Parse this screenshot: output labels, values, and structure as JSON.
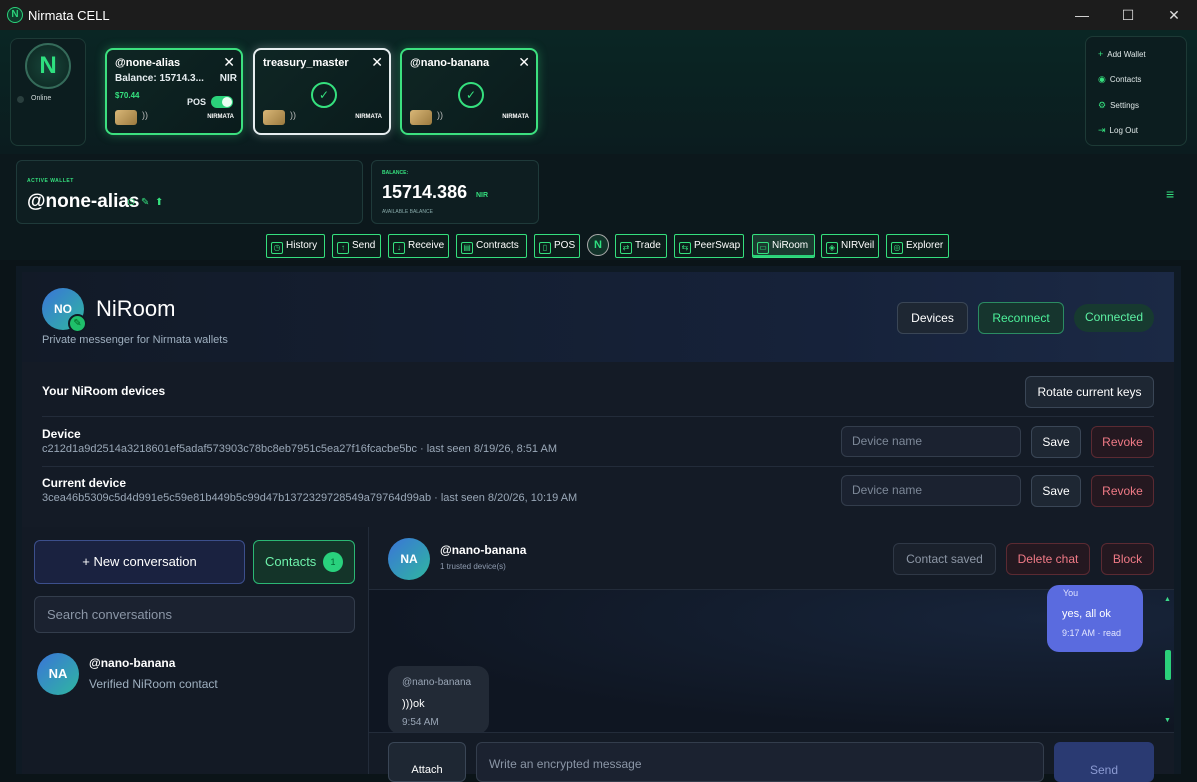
{
  "window": {
    "title": "Nirmata CELL",
    "logo_glyph": "N",
    "minimize": "—",
    "maximize": "☐",
    "close": "✕"
  },
  "profile": {
    "status": "Online",
    "glyph": "N"
  },
  "wallet_cards": [
    {
      "name": "@none-alias",
      "balance": "Balance: 15714.3...",
      "balance_unit": "NIR",
      "usd": "$70.44",
      "pos_label": "POS",
      "pos_enabled": true,
      "brand": "NIRMATA",
      "close": "✕",
      "nfc": "))"
    },
    {
      "name": "treasury_master",
      "brand": "NIRMATA",
      "close": "✕",
      "nfc": "))",
      "shield": "✓"
    },
    {
      "name": "@nano-banana",
      "brand": "NIRMATA",
      "close": "✕",
      "nfc": "))",
      "shield": "✓"
    }
  ],
  "side_menu": [
    {
      "label": "Add Wallet",
      "icon": "+"
    },
    {
      "label": "Contacts",
      "icon": "◉"
    },
    {
      "label": "Settings",
      "icon": "⚙"
    },
    {
      "label": "Log Out",
      "icon": "⇥"
    }
  ],
  "active_wallet": {
    "label": "ACTIVE WALLET",
    "alias": "@none-alias",
    "icons": [
      "⊙",
      "✎",
      "⬆"
    ]
  },
  "balance": {
    "label": "BALANCE:",
    "value": "15714.386",
    "unit": "NIR",
    "sub": "AVAILABLE BALANCE"
  },
  "hamburger": "≡",
  "nav": [
    {
      "label": "History",
      "icon": "◷"
    },
    {
      "label": "Send",
      "icon": "↑"
    },
    {
      "label": "Receive",
      "icon": "↓"
    },
    {
      "label": "Contracts",
      "icon": "▤"
    },
    {
      "label": "POS",
      "icon": "▯"
    },
    {
      "label": "Trade",
      "icon": "⇄"
    },
    {
      "label": "PeerSwap",
      "icon": "⇆"
    },
    {
      "label": "NiRoom",
      "icon": "▭",
      "active": true
    },
    {
      "label": "NIRVeil",
      "icon": "◈"
    },
    {
      "label": "Explorer",
      "icon": "◎"
    }
  ],
  "nav_logo": "N",
  "niroom": {
    "avatar": "NO",
    "badge": "✎",
    "title": "NiRoom",
    "subtitle": "Private messenger for Nirmata wallets",
    "devices_btn": "Devices",
    "reconnect_btn": "Reconnect",
    "status": "Connected"
  },
  "devices": {
    "title": "Your NiRoom devices",
    "rotate_btn": "Rotate current keys",
    "placeholder": "Device name",
    "save": "Save",
    "revoke": "Revoke",
    "list": [
      {
        "label": "Device",
        "id": "c212d1a9d2514a3218601ef5adaf573903c78bc8eb7951c5ea27f16fcacbe5bc · last seen 8/19/26, 8:51 AM"
      },
      {
        "label": "Current device",
        "id": "3cea46b5309c5d4d991e5c59e81b449b5c99d47b1372329728549a79764d99ab · last seen 8/20/26, 10:19 AM"
      }
    ]
  },
  "sidebar": {
    "new_conv": "+ New conversation",
    "contacts": "Contacts",
    "contacts_count": "1",
    "search_placeholder": "Search conversations",
    "conversations": [
      {
        "avatar": "NA",
        "name": "@nano-banana",
        "sub": "Verified NiRoom contact"
      }
    ]
  },
  "chat": {
    "avatar": "NA",
    "name": "@nano-banana",
    "trusted": "1 trusted device(s)",
    "contact_saved": "Contact saved",
    "delete": "Delete chat",
    "block": "Block",
    "messages": [
      {
        "from": "You",
        "text": "yes, all ok",
        "meta": "9:17 AM · read"
      },
      {
        "from": "@nano-banana",
        "text": ")))ok",
        "meta": "9:54 AM"
      }
    ],
    "attach": "Attach",
    "input_placeholder": "Write an encrypted message",
    "send": "Send"
  }
}
